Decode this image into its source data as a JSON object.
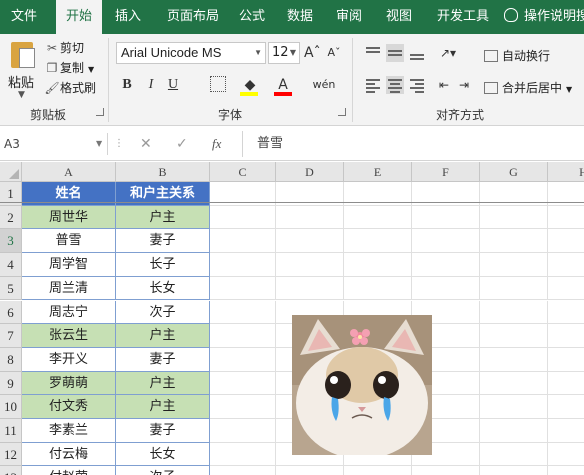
{
  "ribbon_tabs": [
    "文件",
    "开始",
    "插入",
    "页面布局",
    "公式",
    "数据",
    "审阅",
    "视图",
    "开发工具"
  ],
  "active_tab": "开始",
  "tell_me": "操作说明搜",
  "clipboard": {
    "paste": "粘贴",
    "cut": "剪切",
    "copy": "复制",
    "format_painter": "格式刷",
    "group_label": "剪贴板"
  },
  "font": {
    "name": "Arial Unicode MS",
    "size": "12",
    "group_label": "字体",
    "bold": "B",
    "italic": "I",
    "underline": "U",
    "grow": "Aˆ",
    "shrink": "Aˇ",
    "font_color": "A",
    "phonetic": "wén",
    "fill_color": "#ffff00",
    "text_color": "#ff0000"
  },
  "alignment": {
    "wrap_text": "自动换行",
    "merge_center": "合并后居中",
    "group_label": "对齐方式"
  },
  "formula_bar": {
    "name_box": "A3",
    "fx": "fx",
    "content": "普雪"
  },
  "columns": [
    "A",
    "B",
    "C",
    "D",
    "E",
    "F",
    "G",
    "H"
  ],
  "rows": [
    "1",
    "2",
    "3",
    "4",
    "5",
    "6",
    "7",
    "8",
    "9",
    "10",
    "11",
    "12",
    "13"
  ],
  "selected_row": "3",
  "table": {
    "headers": [
      "姓名",
      "和户主关系"
    ],
    "records": [
      {
        "name": "周世华",
        "relation": "户主",
        "head": true
      },
      {
        "name": "普雪",
        "relation": "妻子",
        "head": false
      },
      {
        "name": "周学智",
        "relation": "长子",
        "head": false
      },
      {
        "name": "周兰清",
        "relation": "长女",
        "head": false
      },
      {
        "name": "周志宁",
        "relation": "次子",
        "head": false
      },
      {
        "name": "张云生",
        "relation": "户主",
        "head": true
      },
      {
        "name": "李开义",
        "relation": "妻子",
        "head": false
      },
      {
        "name": "罗萌萌",
        "relation": "户主",
        "head": true
      },
      {
        "name": "付文秀",
        "relation": "户主",
        "head": true
      },
      {
        "name": "李素兰",
        "relation": "妻子",
        "head": false
      },
      {
        "name": "付云梅",
        "relation": "长女",
        "head": false
      },
      {
        "name": "付赵荣",
        "relation": "次子",
        "head": false
      }
    ]
  },
  "colors": {
    "excel_green": "#217346",
    "header_blue": "#4472c4",
    "highlight_green": "#c6e0b4"
  }
}
